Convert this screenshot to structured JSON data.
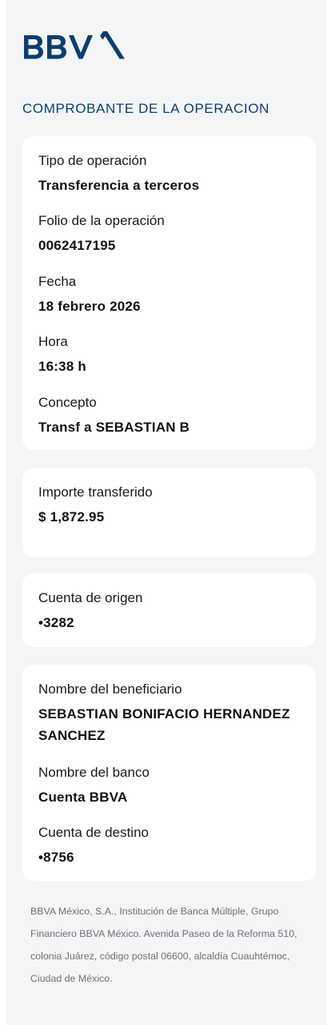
{
  "brand": {
    "logo_text": "BBVA",
    "brand_color": "#0c3e6e"
  },
  "section_title": "COMPROBANTE DE LA OPERACION",
  "operation": {
    "type_label": "Tipo de operación",
    "type_value": "Transferencia a terceros",
    "folio_label": "Folio de la operación",
    "folio_value": "0062417195",
    "date_label": "Fecha",
    "date_value": "18 febrero 2026",
    "time_label": "Hora",
    "time_value": "16:38 h",
    "concept_label": "Concepto",
    "concept_value": "Transf a SEBASTIAN B"
  },
  "amount": {
    "label": "Importe transferido",
    "value": "$ 1,872.95"
  },
  "origin": {
    "label": "Cuenta de origen",
    "value": "•3282"
  },
  "beneficiary": {
    "name_label": "Nombre del beneficiario",
    "name_value": "SEBASTIAN BONIFACIO HERNANDEZ SANCHEZ",
    "bank_label": "Nombre del banco",
    "bank_value": "Cuenta BBVA",
    "dest_label": "Cuenta de destino",
    "dest_value": "•8756"
  },
  "footer_text": "BBVA México, S.A., Institución de Banca Múltiple, Grupo Financiero BBVA México. Avenida Paseo de la Reforma 510, colonia Juárez, código postal 06600, alcaldía Cuauhtémoc, Ciudad de México."
}
